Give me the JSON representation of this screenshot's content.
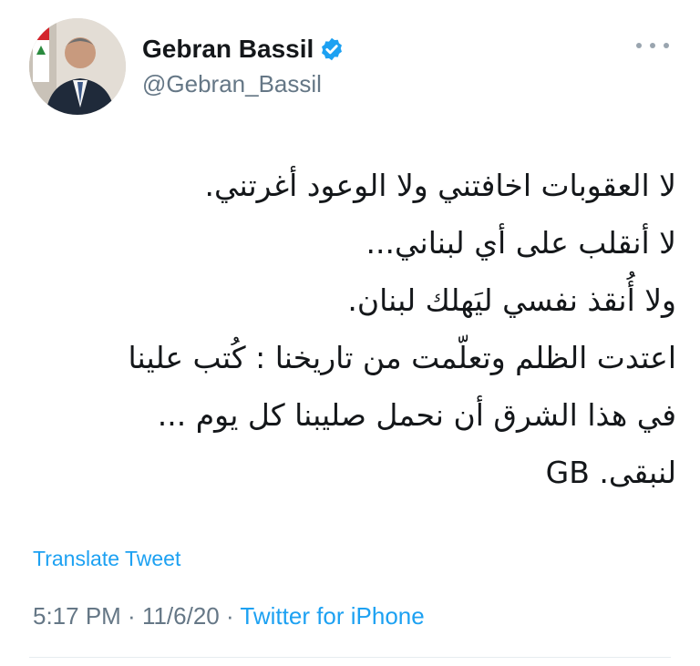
{
  "author": {
    "display_name": "Gebran Bassil",
    "handle": "@Gebran_Bassil",
    "verified": true,
    "avatar_icon": "profile-photo",
    "verified_icon": "verified-badge-icon",
    "verified_color": "#1da1f2"
  },
  "tweet": {
    "lines": [
      "لا العقوبات اخافتني ولا الوعود أغرتني.",
      "لا أنقلب على أي لبناني...",
      "ولا أُنقذ نفسي ليَهلك لبنان.",
      "اعتدت الظلم وتعلّمت من تاريخنا : كُتب علينا",
      "في هذا الشرق أن نحمل صليبنا كل يوم ...",
      "لنبقى. GB"
    ]
  },
  "translate_label": "Translate Tweet",
  "meta": {
    "time": "5:17 PM",
    "separator": " · ",
    "date": "11/6/20",
    "source": "Twitter for iPhone"
  },
  "colors": {
    "link": "#1da1f2",
    "secondary_text": "#657786",
    "primary_text": "#14171a",
    "divider": "#e6ecf0"
  }
}
